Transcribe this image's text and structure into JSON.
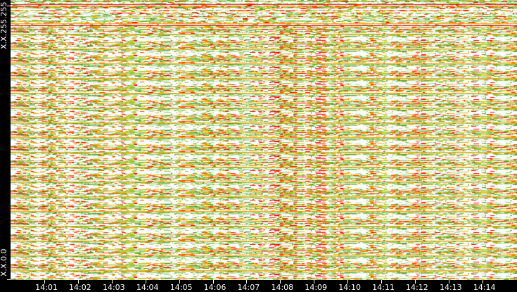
{
  "chart_data": {
    "type": "heatmap",
    "title": "",
    "xlabel": "",
    "ylabel": "",
    "x_tick_labels": [
      "14:01",
      "14:02",
      "14:03",
      "14:04",
      "14:05",
      "14:06",
      "14:07",
      "14:08",
      "14:09",
      "14:10",
      "14:11",
      "14:12",
      "14:13",
      "14:14"
    ],
    "y_tick_labels": [
      "X.X.255.255",
      "X.X.0.0"
    ],
    "y_range": [
      "X.X.0.0",
      "X.X.255.255"
    ],
    "color_scale": [
      "#ffffff",
      "#b5d99c",
      "#8cc152",
      "#5a9a2a",
      "#c8c800",
      "#ffa500",
      "#ff4000",
      "#ff0000",
      "#b00000"
    ],
    "grid": false
  }
}
